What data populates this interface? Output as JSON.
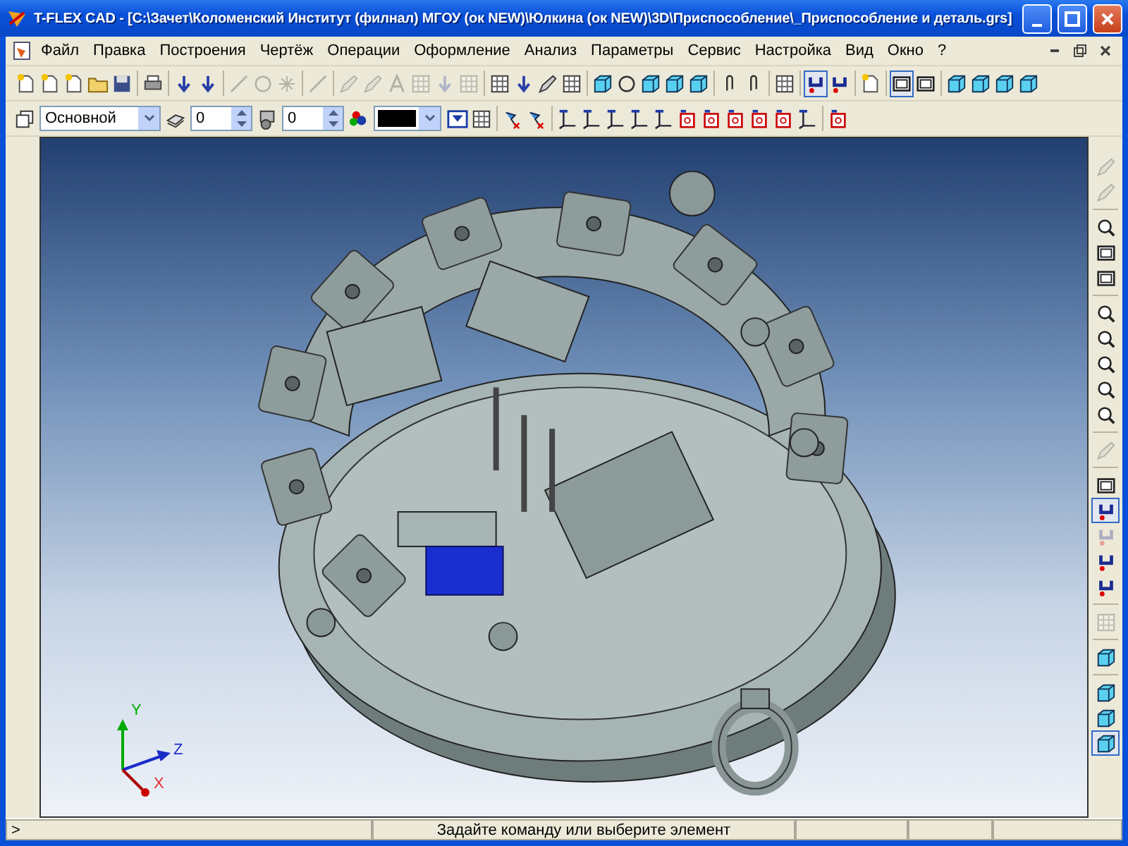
{
  "window": {
    "title": "T-FLEX CAD - [C:\\Зачет\\Коломенский Институт (филнал) МГОУ (ок NEW)\\Юлкина (ок NEW)\\3D\\Приспособление\\_Приспособление и деталь.grs]"
  },
  "menu": [
    {
      "label": "Файл"
    },
    {
      "label": "Правка"
    },
    {
      "label": "Построения"
    },
    {
      "label": "Чертёж"
    },
    {
      "label": "Операции"
    },
    {
      "label": "Оформление"
    },
    {
      "label": "Анализ"
    },
    {
      "label": "Параметры"
    },
    {
      "label": "Сервис"
    },
    {
      "label": "Настройка"
    },
    {
      "label": "Вид"
    },
    {
      "label": "Окно"
    },
    {
      "label": "?"
    }
  ],
  "toolbar_main": [
    {
      "kind": "button",
      "disabled": false,
      "pressed": false
    },
    {
      "kind": "button",
      "disabled": false,
      "pressed": false
    },
    {
      "kind": "button",
      "disabled": false,
      "pressed": false
    },
    {
      "kind": "button",
      "disabled": false,
      "pressed": false
    },
    {
      "kind": "button",
      "disabled": false,
      "pressed": false
    },
    {
      "kind": "separator"
    },
    {
      "kind": "button",
      "disabled": false,
      "pressed": false
    },
    {
      "kind": "separator"
    },
    {
      "kind": "button",
      "disabled": false,
      "pressed": false
    },
    {
      "kind": "button",
      "disabled": false,
      "pressed": false
    },
    {
      "kind": "separator"
    },
    {
      "kind": "button",
      "disabled": true,
      "pressed": false
    },
    {
      "kind": "button",
      "disabled": true,
      "pressed": false
    },
    {
      "kind": "button",
      "disabled": true,
      "pressed": false
    },
    {
      "kind": "separator"
    },
    {
      "kind": "button",
      "disabled": true,
      "pressed": false
    },
    {
      "kind": "separator"
    },
    {
      "kind": "button",
      "disabled": true,
      "pressed": false
    },
    {
      "kind": "button",
      "disabled": true,
      "pressed": false
    },
    {
      "kind": "button",
      "disabled": true,
      "pressed": false
    },
    {
      "kind": "button",
      "disabled": true,
      "pressed": false
    },
    {
      "kind": "button",
      "disabled": true,
      "pressed": false
    },
    {
      "kind": "button",
      "disabled": true,
      "pressed": false
    },
    {
      "kind": "separator"
    },
    {
      "kind": "button",
      "disabled": false,
      "pressed": false
    },
    {
      "kind": "button",
      "disabled": false,
      "pressed": false
    },
    {
      "kind": "button",
      "disabled": false,
      "pressed": false
    },
    {
      "kind": "button",
      "disabled": false,
      "pressed": false
    },
    {
      "kind": "separator"
    },
    {
      "kind": "button",
      "disabled": false,
      "pressed": false
    },
    {
      "kind": "button",
      "disabled": false,
      "pressed": false
    },
    {
      "kind": "button",
      "disabled": false,
      "pressed": false
    },
    {
      "kind": "button",
      "disabled": false,
      "pressed": false
    },
    {
      "kind": "button",
      "disabled": false,
      "pressed": false
    },
    {
      "kind": "separator"
    },
    {
      "kind": "button",
      "disabled": false,
      "pressed": false
    },
    {
      "kind": "button",
      "disabled": false,
      "pressed": false
    },
    {
      "kind": "separator"
    },
    {
      "kind": "button",
      "disabled": false,
      "pressed": false
    },
    {
      "kind": "separator"
    },
    {
      "kind": "button",
      "disabled": false,
      "pressed": true
    },
    {
      "kind": "button",
      "disabled": false,
      "pressed": false
    },
    {
      "kind": "separator"
    },
    {
      "kind": "button",
      "disabled": false,
      "pressed": false
    },
    {
      "kind": "separator"
    },
    {
      "kind": "button",
      "disabled": false,
      "pressed": true
    },
    {
      "kind": "button",
      "disabled": false,
      "pressed": false
    },
    {
      "kind": "separator"
    },
    {
      "kind": "button",
      "disabled": false,
      "pressed": false
    },
    {
      "kind": "button",
      "disabled": false,
      "pressed": false
    },
    {
      "kind": "button",
      "disabled": false,
      "pressed": false
    },
    {
      "kind": "button",
      "disabled": false,
      "pressed": false
    }
  ],
  "toolbar_properties": {
    "layer": "Основной",
    "level": "0",
    "priority": "0",
    "tools": [
      {
        "kind": "button",
        "pressed": false
      },
      {
        "kind": "button",
        "pressed": false
      },
      {
        "kind": "separator"
      },
      {
        "kind": "button",
        "pressed": false
      },
      {
        "kind": "button",
        "pressed": false
      },
      {
        "kind": "separator"
      },
      {
        "kind": "button",
        "pressed": false
      },
      {
        "kind": "button",
        "pressed": false
      },
      {
        "kind": "button",
        "pressed": false
      },
      {
        "kind": "button",
        "pressed": false
      },
      {
        "kind": "button",
        "pressed": false
      },
      {
        "kind": "button",
        "pressed": false
      },
      {
        "kind": "button",
        "pressed": false
      },
      {
        "kind": "button",
        "pressed": false
      },
      {
        "kind": "button",
        "pressed": false
      },
      {
        "kind": "button",
        "pressed": false
      },
      {
        "kind": "button",
        "pressed": false
      },
      {
        "kind": "separator"
      },
      {
        "kind": "button",
        "pressed": false
      }
    ]
  },
  "toolbar_view": [
    {
      "kind": "button",
      "disabled": true,
      "pressed": false
    },
    {
      "kind": "button",
      "disabled": true,
      "pressed": false
    },
    {
      "kind": "separator"
    },
    {
      "kind": "button",
      "disabled": false,
      "pressed": false
    },
    {
      "kind": "button",
      "disabled": false,
      "pressed": false
    },
    {
      "kind": "button",
      "disabled": false,
      "pressed": false
    },
    {
      "kind": "separator"
    },
    {
      "kind": "button",
      "disabled": false,
      "pressed": false
    },
    {
      "kind": "button",
      "disabled": false,
      "pressed": false
    },
    {
      "kind": "button",
      "disabled": false,
      "pressed": false
    },
    {
      "kind": "button",
      "disabled": false,
      "pressed": false
    },
    {
      "kind": "button",
      "disabled": false,
      "pressed": false
    },
    {
      "kind": "separator"
    },
    {
      "kind": "button",
      "disabled": true,
      "pressed": false
    },
    {
      "kind": "separator"
    },
    {
      "kind": "button",
      "disabled": false,
      "pressed": false
    },
    {
      "kind": "button",
      "disabled": false,
      "pressed": true
    },
    {
      "kind": "button",
      "disabled": true,
      "pressed": false
    },
    {
      "kind": "button",
      "disabled": false,
      "pressed": false
    },
    {
      "kind": "button",
      "disabled": false,
      "pressed": false
    },
    {
      "kind": "separator"
    },
    {
      "kind": "button",
      "disabled": true,
      "pressed": false
    },
    {
      "kind": "separator"
    },
    {
      "kind": "button",
      "disabled": false,
      "pressed": false
    },
    {
      "kind": "separator"
    },
    {
      "kind": "button",
      "disabled": false,
      "pressed": false
    },
    {
      "kind": "button",
      "disabled": false,
      "pressed": false
    },
    {
      "kind": "button",
      "disabled": false,
      "pressed": true
    }
  ],
  "axes": [
    {
      "label": "Y"
    },
    {
      "label": "Z"
    },
    {
      "label": "X"
    }
  ],
  "status_bar": {
    "prompt": ">",
    "message": "Задайте команду или выберите элемент"
  }
}
